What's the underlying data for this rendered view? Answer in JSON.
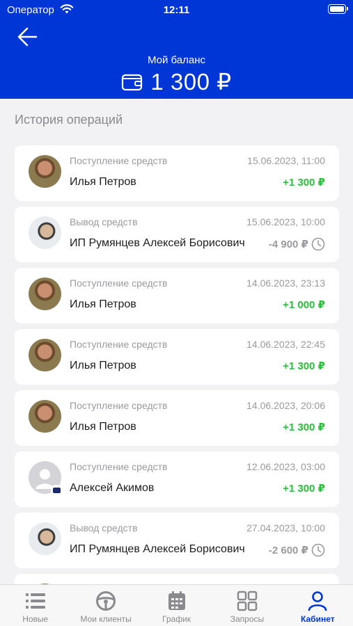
{
  "status_bar": {
    "carrier": "Оператор",
    "time": "12:11"
  },
  "header": {
    "balance_label": "Мой баланс",
    "balance_amount": "1 300 ₽",
    "back_icon": "arrow-left-icon",
    "wallet_icon": "wallet-icon"
  },
  "history": {
    "title": "История операций",
    "items": [
      {
        "type": "Поступление средств",
        "date": "15.06.2023, 11:00",
        "name": "Илья Петров",
        "amount": "+1 300 ₽",
        "direction": "in"
      },
      {
        "type": "Вывод средств",
        "date": "15.06.2023, 10:00",
        "name": "ИП Румянцев Алексей Борисович",
        "amount": "-4 900 ₽",
        "direction": "out"
      },
      {
        "type": "Поступление средств",
        "date": "14.06.2023, 23:13",
        "name": "Илья Петров",
        "amount": "+1 000 ₽",
        "direction": "in"
      },
      {
        "type": "Поступление средств",
        "date": "14.06.2023, 22:45",
        "name": "Илья Петров",
        "amount": "+1 300 ₽",
        "direction": "in"
      },
      {
        "type": "Поступление средств",
        "date": "14.06.2023, 20:06",
        "name": "Илья Петров",
        "amount": "+1 300 ₽",
        "direction": "in"
      },
      {
        "type": "Поступление средств",
        "date": "12.06.2023, 03:00",
        "name": "Алексей Акимов",
        "amount": "+1 300 ₽",
        "direction": "in"
      },
      {
        "type": "Вывод средств",
        "date": "27.04.2023, 10:00",
        "name": "ИП Румянцев Алексей Борисович",
        "amount": "-2 600 ₽",
        "direction": "out"
      }
    ]
  },
  "tabs": [
    {
      "label": "Новые",
      "icon": "list-icon",
      "active": false
    },
    {
      "label": "Мои клиенты",
      "icon": "steering-wheel-icon",
      "active": false
    },
    {
      "label": "График",
      "icon": "calendar-icon",
      "active": false
    },
    {
      "label": "Запросы",
      "icon": "grid-icon",
      "active": false
    },
    {
      "label": "Кабинет",
      "icon": "user-icon",
      "active": true
    }
  ],
  "colors": {
    "brand": "#0035d6",
    "income": "#2bbd3c",
    "withdrawal": "#9a9aa0"
  }
}
